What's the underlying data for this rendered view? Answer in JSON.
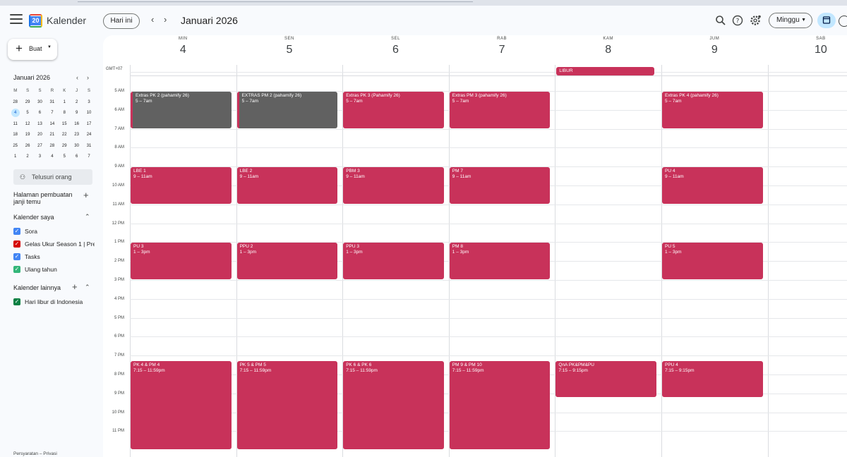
{
  "app": {
    "name": "Kalender",
    "logo_day": "20"
  },
  "header": {
    "today_label": "Hari ini",
    "month_title": "Januari 2026",
    "view_label": "Minggu"
  },
  "sidebar": {
    "create_label": "Buat",
    "mini_calendar": {
      "title": "Januari 2026",
      "weekdays": [
        "M",
        "S",
        "S",
        "R",
        "K",
        "J",
        "S"
      ],
      "weeks": [
        [
          "28",
          "29",
          "30",
          "31",
          "1",
          "2",
          "3"
        ],
        [
          "4",
          "5",
          "6",
          "7",
          "8",
          "9",
          "10"
        ],
        [
          "11",
          "12",
          "13",
          "14",
          "15",
          "16",
          "17"
        ],
        [
          "18",
          "19",
          "20",
          "21",
          "22",
          "23",
          "24"
        ],
        [
          "25",
          "26",
          "27",
          "28",
          "29",
          "30",
          "31"
        ],
        [
          "1",
          "2",
          "3",
          "4",
          "5",
          "6",
          "7"
        ]
      ],
      "today": "4"
    },
    "search_people": "Telusuri orang",
    "booking_pages": "Halaman pembuatan janji temu",
    "my_calendars_title": "Kalender saya",
    "my_calendars": [
      {
        "name": "Sora",
        "color": "#4285f4"
      },
      {
        "name": "Gelas Ukur Season 1 | Pre...",
        "color": "#d50000"
      },
      {
        "name": "Tasks",
        "color": "#4285f4"
      },
      {
        "name": "Ulang tahun",
        "color": "#33b679"
      }
    ],
    "other_calendars_title": "Kalender lainnya",
    "other_calendars": [
      {
        "name": "Hari libur di Indonesia",
        "color": "#0b8043"
      }
    ],
    "footer": "Persyaratan – Privasi"
  },
  "week": {
    "timezone": "GMT+07",
    "days": [
      {
        "dow": "MIN",
        "num": "4"
      },
      {
        "dow": "SEN",
        "num": "5"
      },
      {
        "dow": "SEL",
        "num": "6"
      },
      {
        "dow": "RAB",
        "num": "7"
      },
      {
        "dow": "KAM",
        "num": "8"
      },
      {
        "dow": "JUM",
        "num": "9"
      },
      {
        "dow": "SAB",
        "num": "10"
      }
    ],
    "hours": [
      "5 AM",
      "6 AM",
      "7 AM",
      "8 AM",
      "9 AM",
      "10 AM",
      "11 AM",
      "12 PM",
      "1 PM",
      "2 PM",
      "3 PM",
      "4 PM",
      "5 PM",
      "6 PM",
      "7 PM",
      "8 PM",
      "9 PM",
      "10 PM",
      "11 PM"
    ],
    "holiday": {
      "day": 4,
      "title": "LIBUR",
      "color": "#c8325a"
    },
    "colors": {
      "event": "#c8325a",
      "grey_event": "#616161",
      "today_bg": "#c2e7ff",
      "accent": "#0b57d0"
    },
    "events": [
      {
        "day": 0,
        "start": 5,
        "end": 7,
        "title": "Extras PK 2 (pahamify 26)",
        "time": "5 – 7am",
        "grey": true
      },
      {
        "day": 1,
        "start": 5,
        "end": 7,
        "title": "EXTRAS PM 2 (pahamify 26)",
        "time": "5 – 7am",
        "grey": true
      },
      {
        "day": 2,
        "start": 5,
        "end": 7,
        "title": "Extras PK 3 (Pahamify 26)",
        "time": "5 – 7am"
      },
      {
        "day": 3,
        "start": 5,
        "end": 7,
        "title": "Extras PM 3 (pahamify 26)",
        "time": "5 – 7am"
      },
      {
        "day": 5,
        "start": 5,
        "end": 7,
        "title": "Extras PK 4 (pahamify 26)",
        "time": "5 – 7am"
      },
      {
        "day": 0,
        "start": 9,
        "end": 11,
        "title": "LBE 1",
        "time": "9 – 11am"
      },
      {
        "day": 1,
        "start": 9,
        "end": 11,
        "title": "LBE 2",
        "time": "9 – 11am"
      },
      {
        "day": 2,
        "start": 9,
        "end": 11,
        "title": "PBM 3",
        "time": "9 – 11am"
      },
      {
        "day": 3,
        "start": 9,
        "end": 11,
        "title": "PM 7",
        "time": "9 – 11am"
      },
      {
        "day": 5,
        "start": 9,
        "end": 11,
        "title": "PU 4",
        "time": "9 – 11am"
      },
      {
        "day": 0,
        "start": 13,
        "end": 15,
        "title": "PU 3",
        "time": "1 – 3pm"
      },
      {
        "day": 1,
        "start": 13,
        "end": 15,
        "title": "PPU 2",
        "time": "1 – 3pm"
      },
      {
        "day": 2,
        "start": 13,
        "end": 15,
        "title": "PPU 3",
        "time": "1 – 3pm"
      },
      {
        "day": 3,
        "start": 13,
        "end": 15,
        "title": "PM 8",
        "time": "1 – 3pm"
      },
      {
        "day": 5,
        "start": 13,
        "end": 15,
        "title": "PU 5",
        "time": "1 – 3pm"
      },
      {
        "day": 0,
        "start": 19.25,
        "end": 23.983,
        "title": "PK 4 & PM 4",
        "time": "7:15 – 11:59pm"
      },
      {
        "day": 1,
        "start": 19.25,
        "end": 23.983,
        "title": "PK 5 & PM 5",
        "time": "7:15 – 11:59pm"
      },
      {
        "day": 2,
        "start": 19.25,
        "end": 23.983,
        "title": "PK 6 & PK 6",
        "time": "7:15 – 11:59pm"
      },
      {
        "day": 3,
        "start": 19.25,
        "end": 23.983,
        "title": "PM 9 & PM 10",
        "time": "7:15 – 11:59pm"
      },
      {
        "day": 4,
        "start": 19.25,
        "end": 21.25,
        "title": "QnA PK&PM&PU",
        "time": "7:15 – 9:15pm"
      },
      {
        "day": 5,
        "start": 19.25,
        "end": 21.25,
        "title": "PPU 4",
        "time": "7:15 – 9:15pm"
      }
    ]
  }
}
